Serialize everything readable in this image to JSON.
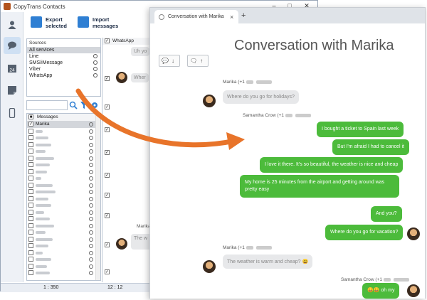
{
  "ct": {
    "title": "CopyTrans Contacts",
    "toolbar": {
      "export_label": "Export\nselected",
      "import_label": "Import\nmessages"
    },
    "sources": {
      "header": "Sources",
      "items": [
        "All services",
        "Line",
        "SMS/iMessage",
        "Viber",
        "WhatsApp"
      ],
      "selected_index": 0
    },
    "messages_header": "Messages",
    "contact_selected": "Marika",
    "whatsapp_label": "WhatsApp",
    "status": {
      "count": "1 : 350",
      "time": "12 : 12"
    },
    "conv_preview": [
      {
        "name": "",
        "text": "Uh yo"
      },
      {
        "name": "",
        "text": "Wher"
      },
      {
        "name": "Marika",
        "text": "The w"
      }
    ]
  },
  "browser": {
    "tab_title": "Conversation with Marika",
    "tab_close": "×",
    "new_tab": "+"
  },
  "conversation": {
    "title": "Conversation with Marika",
    "toolbar": {
      "group1": [
        "💬",
        "↓"
      ],
      "group2": [
        "🗨",
        "↑"
      ]
    },
    "senders": {
      "marika_1": "Marika (+1",
      "samantha_1": "Samantha Crow (+1",
      "marika_2": "Marika (+1",
      "samantha_2": "Samantha Crow (+1"
    },
    "incoming": {
      "m1": "Where do you go for holidays?",
      "m2": "The weather is warm and cheap? 😀"
    },
    "outgoing": [
      "I bought a ticket to Spain last week",
      "But I'm afraid I had to cancel it",
      "I love it there. It's so beautiful, the weather is nice and cheap",
      "My home is 25 minutes from the airport and getting around was pretty easy",
      "And you?",
      "Where do you go for vacation?",
      "😀😀 oh my"
    ]
  },
  "colors": {
    "bubble_out": "#4cbb3b",
    "bubble_in": "#e7e8ea",
    "arrow": "#e8742a",
    "sidebar_active": "#cfe0f3"
  }
}
